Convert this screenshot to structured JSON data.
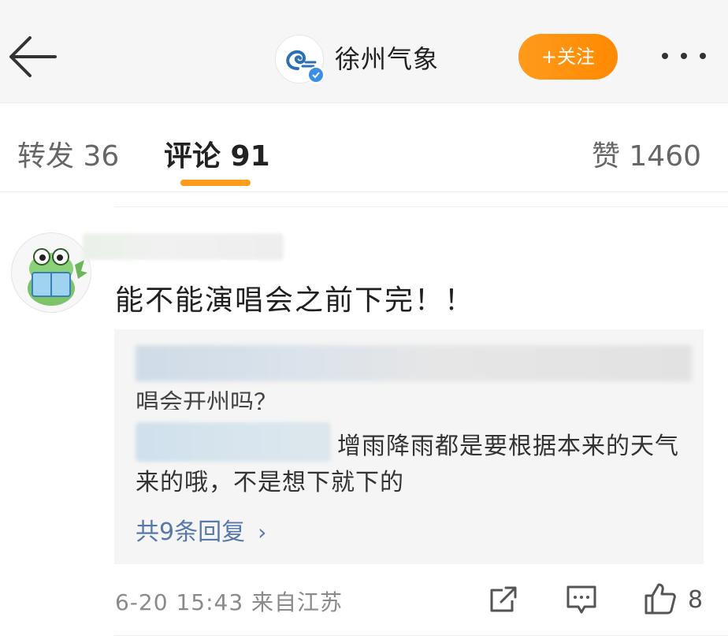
{
  "header": {
    "account_name": "徐州气象",
    "follow_label": "+关注",
    "icons": [
      "back-arrow-icon",
      "weather-logo-icon",
      "verified-badge-icon",
      "more-icon"
    ]
  },
  "tabs": {
    "reposts": "转发 36",
    "comments": "评论 91",
    "likes": "赞 1460",
    "active": "comments",
    "accent_color": "#ff9b1a"
  },
  "comment": {
    "text": "能不能演唱会之前下完！！",
    "replies": {
      "partial_text": "唱会开州吗？",
      "reply_text": "增雨降雨都是要根据本来的天气来的哦，不是想下就下的",
      "view_more": "共9条回复",
      "chevron": "›"
    },
    "meta": "6-20 15:43 来自江苏",
    "like_count": "8",
    "icons": [
      "share-icon",
      "comment-icon",
      "like-icon"
    ]
  }
}
